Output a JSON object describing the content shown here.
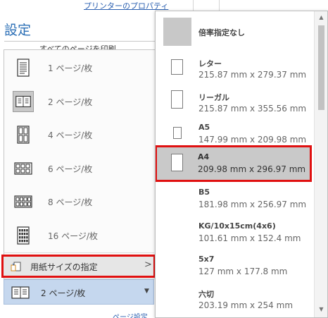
{
  "printer_properties_link": "プリンターのプロパティ",
  "settings_title": "設定",
  "print_all_pages": "すべてのページを印刷",
  "page_setup_link": "ページ設定",
  "pages_per_sheet": {
    "items": [
      {
        "label": "1 ページ/枚",
        "icon": "1-page-icon"
      },
      {
        "label": "2 ページ/枚",
        "icon": "2-pages-icon",
        "selected": true
      },
      {
        "label": "4 ページ/枚",
        "icon": "4-pages-icon"
      },
      {
        "label": "6 ページ/枚",
        "icon": "6-pages-icon"
      },
      {
        "label": "8 ページ/枚",
        "icon": "8-pages-icon"
      },
      {
        "label": "16 ページ/枚",
        "icon": "16-pages-icon"
      }
    ],
    "scale_to_paper_label": "用紙サイズの指定",
    "current_value": "2 ページ/枚"
  },
  "paper_sizes": [
    {
      "name": "倍率指定なし",
      "dimensions": ""
    },
    {
      "name": "レター",
      "dimensions": "215.87 mm x 279.37 mm"
    },
    {
      "name": "リーガル",
      "dimensions": "215.87 mm x 355.56 mm"
    },
    {
      "name": "A5",
      "dimensions": "147.99 mm x 209.98 mm"
    },
    {
      "name": "A4",
      "dimensions": "209.98 mm x 296.97 mm",
      "selected": true
    },
    {
      "name": "B5",
      "dimensions": "181.98 mm x 256.97 mm"
    },
    {
      "name": "KG/10x15cm(4x6)",
      "dimensions": "101.61 mm x 152.4 mm"
    },
    {
      "name": "5x7",
      "dimensions": "127 mm x 177.8 mm"
    },
    {
      "name": "六切",
      "dimensions": "203.19 mm x 254 mm"
    }
  ],
  "colors": {
    "highlight_border": "#e01010",
    "selected_bg": "#c9c9c9",
    "dropdown_bg": "#c5d7ee",
    "title_blue": "#2b6fb6"
  }
}
